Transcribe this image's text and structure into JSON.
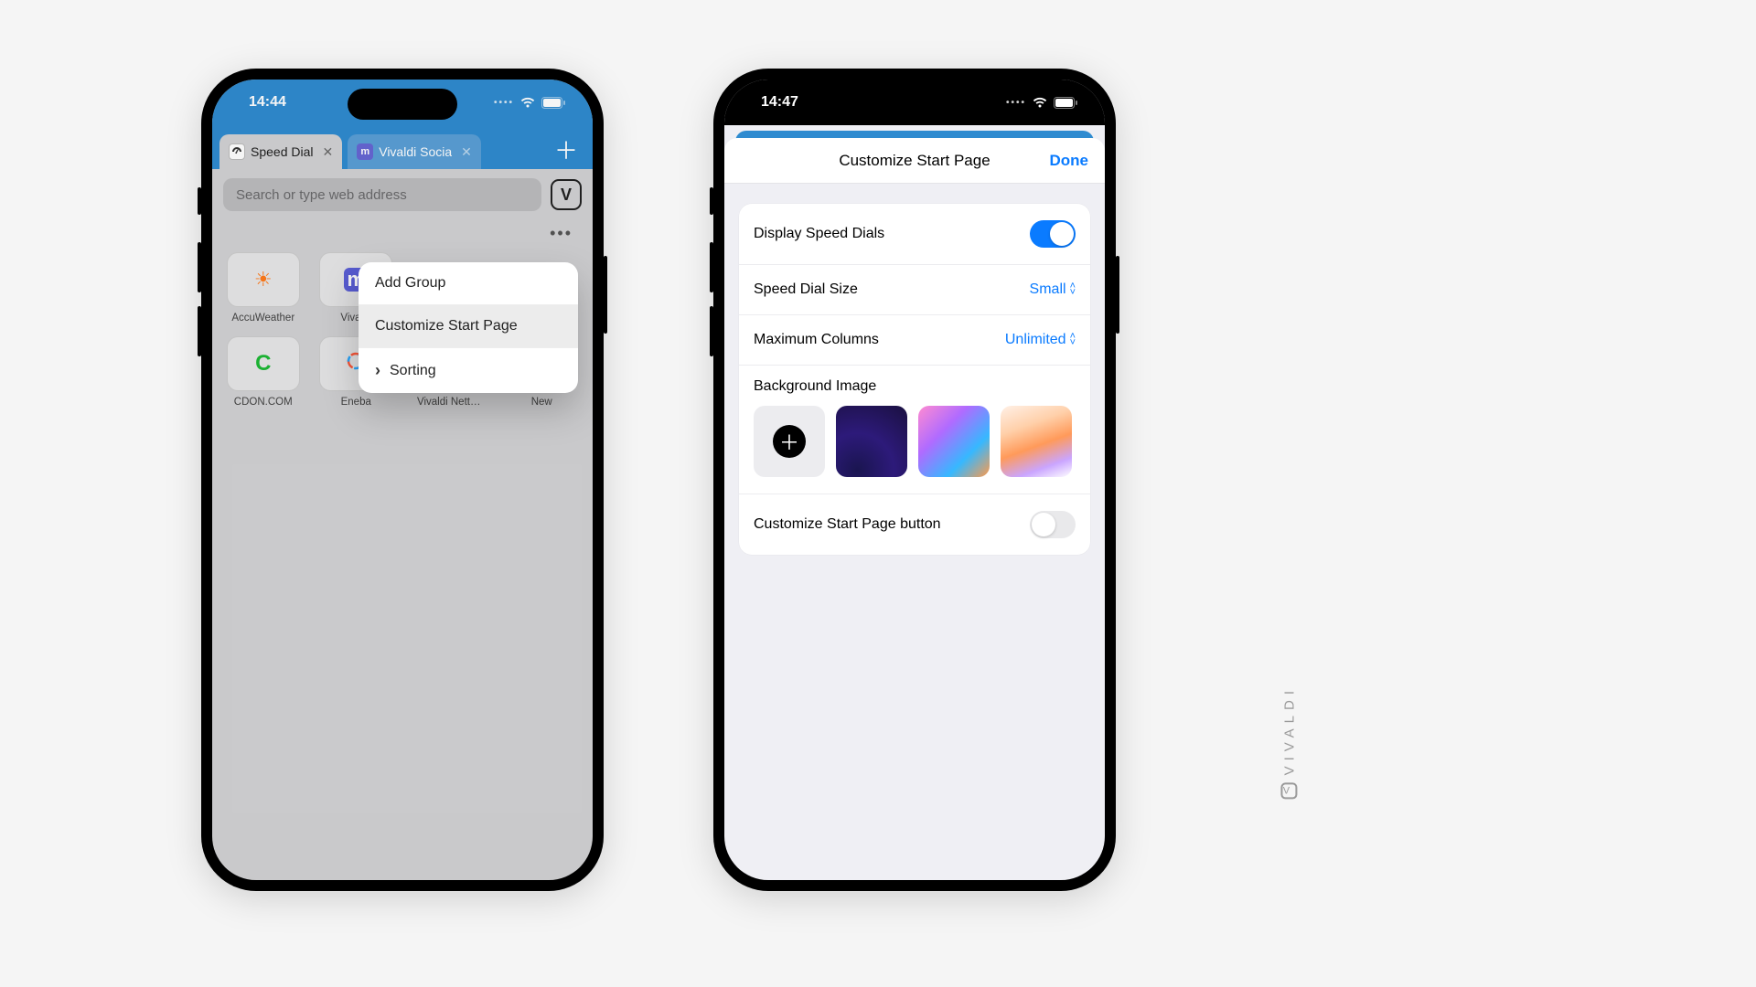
{
  "watermark": "VIVALDI",
  "phone1": {
    "time": "14:44",
    "tabs": {
      "active": "Speed Dial",
      "inactive": "Vivaldi Socia"
    },
    "address_placeholder": "Search or type web address",
    "dials": [
      {
        "label": "AccuWeather"
      },
      {
        "label": "Vivaldi"
      },
      {
        "label": "CDON.COM"
      },
      {
        "label": "Eneba"
      },
      {
        "label": "Vivaldi Nett…"
      },
      {
        "label": "New"
      }
    ],
    "menu": {
      "add_group": "Add Group",
      "customize": "Customize Start Page",
      "sorting": "Sorting"
    }
  },
  "phone2": {
    "time": "14:47",
    "sheet_title": "Customize Start Page",
    "done": "Done",
    "rows": {
      "display_speed_dials": "Display Speed Dials",
      "speed_dial_size": "Speed Dial Size",
      "speed_dial_size_value": "Small",
      "max_columns": "Maximum Columns",
      "max_columns_value": "Unlimited",
      "background_image": "Background Image",
      "customize_button": "Customize Start Page button"
    }
  }
}
